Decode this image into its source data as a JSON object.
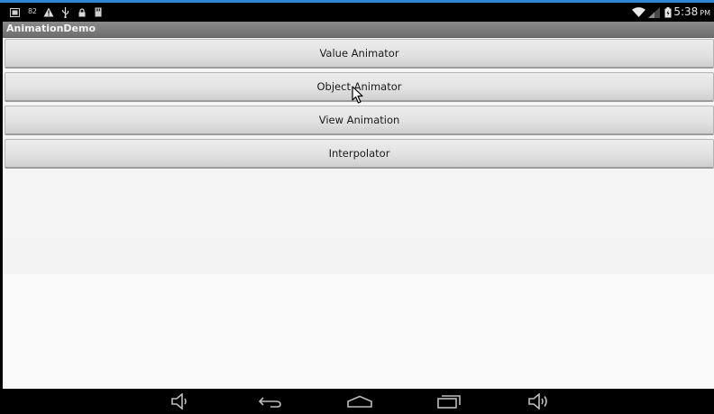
{
  "status_bar": {
    "notification_text": "82",
    "time": "5:38",
    "ampm": "PM",
    "icons": [
      "screenshot-icon",
      "notification-icon",
      "warning-icon",
      "usb-icon",
      "lock-icon",
      "sd-card-icon",
      "wifi-icon",
      "signal-icon",
      "battery-icon"
    ]
  },
  "action_bar": {
    "title": "AnimationDemo"
  },
  "buttons": [
    {
      "label": "Value Animator"
    },
    {
      "label": "Object Animator"
    },
    {
      "label": "View Animation"
    },
    {
      "label": "Interpolator"
    }
  ],
  "nav_bar": {
    "icons": [
      "volume-down-icon",
      "back-icon",
      "home-icon",
      "recents-icon",
      "volume-up-icon"
    ]
  },
  "colors": {
    "top_edge": "#2f86d4",
    "action_bar": "#7c7c7c",
    "status_bar": "#000000",
    "nav_bar": "#000000"
  }
}
